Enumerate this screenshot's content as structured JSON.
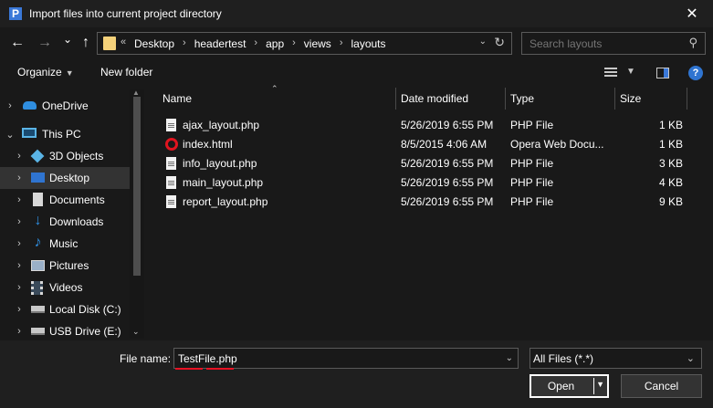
{
  "window": {
    "title": "Import files into current project directory",
    "app_icon_letter": "P",
    "close_glyph": "✕"
  },
  "nav": {
    "back_glyph": "←",
    "forward_glyph": "→",
    "recent_glyph": "⌄",
    "up_glyph": "↑"
  },
  "address": {
    "overflow": "«",
    "crumbs": [
      "Desktop",
      "headertest",
      "app",
      "views",
      "layouts"
    ],
    "separator": "›"
  },
  "search": {
    "placeholder": "Search layouts",
    "icon": "search-icon"
  },
  "toolbar": {
    "organize_label": "Organize",
    "new_folder_label": "New folder"
  },
  "sidebar": {
    "items": [
      {
        "label": "OneDrive",
        "icon": "cloud-icon",
        "color": "#2f8ee0"
      },
      {
        "label": "This PC",
        "icon": "computer-icon",
        "color": "#5ab4e6"
      },
      {
        "label": "3D Objects",
        "icon": "cube-icon",
        "color": "#5ab4e6"
      },
      {
        "label": "Desktop",
        "icon": "desktop-icon",
        "color": "#2f74d0"
      },
      {
        "label": "Documents",
        "icon": "document-icon",
        "color": "#d8d8d8"
      },
      {
        "label": "Downloads",
        "icon": "download-icon",
        "color": "#2f8ee0"
      },
      {
        "label": "Music",
        "icon": "music-icon",
        "color": "#2f8ee0"
      },
      {
        "label": "Pictures",
        "icon": "pictures-icon",
        "color": "#9ab0c8"
      },
      {
        "label": "Videos",
        "icon": "videos-icon",
        "color": "#9ab0c8"
      },
      {
        "label": "Local Disk (C:)",
        "icon": "disk-icon",
        "color": "#c8c8c8"
      },
      {
        "label": "USB Drive (E:)",
        "icon": "usb-drive-icon",
        "color": "#c8c8c8"
      }
    ]
  },
  "columns": {
    "name": "Name",
    "date": "Date modified",
    "type": "Type",
    "size": "Size"
  },
  "files": [
    {
      "name": "ajax_layout.php",
      "date": "5/26/2019 6:55 PM",
      "type": "PHP File",
      "size": "1 KB",
      "icon": "php-file-icon"
    },
    {
      "name": "index.html",
      "date": "8/5/2015 4:06 AM",
      "type": "Opera Web Docu...",
      "size": "1 KB",
      "icon": "opera-icon"
    },
    {
      "name": "info_layout.php",
      "date": "5/26/2019 6:55 PM",
      "type": "PHP File",
      "size": "3 KB",
      "icon": "php-file-icon"
    },
    {
      "name": "main_layout.php",
      "date": "5/26/2019 6:55 PM",
      "type": "PHP File",
      "size": "4 KB",
      "icon": "php-file-icon"
    },
    {
      "name": "report_layout.php",
      "date": "5/26/2019 6:55 PM",
      "type": "PHP File",
      "size": "9 KB",
      "icon": "php-file-icon"
    }
  ],
  "footer": {
    "file_name_label": "File name:",
    "file_name_value": "TestFile.php",
    "file_type_value": "All Files (*.*)",
    "open_label": "Open",
    "cancel_label": "Cancel"
  }
}
